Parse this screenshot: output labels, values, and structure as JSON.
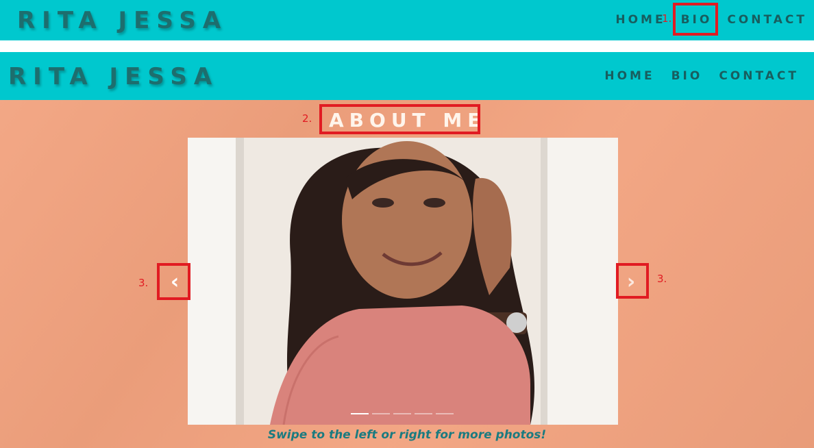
{
  "top_nav": {
    "brand": "RITA JESSA",
    "links": [
      "HOME",
      "BIO",
      "CONTACT"
    ]
  },
  "main_nav": {
    "brand": "RITA JESSA",
    "links": [
      "HOME",
      "BIO",
      "CONTACT"
    ]
  },
  "about": {
    "title": "ABOUT ME",
    "carousel": {
      "prev_icon": "chevron-left-icon",
      "next_icon": "chevron-right-icon",
      "slide_count": 5,
      "active_slide": 1
    },
    "caption": "Swipe to the left or right for more photos!"
  },
  "annotations": {
    "bio_marker": "1.",
    "title_marker": "2.",
    "prev_marker": "3.",
    "next_marker": "3."
  },
  "colors": {
    "header_bg": "#00c8ce",
    "brand_text": "#1d6e6e",
    "content_bg": "#f2a27e",
    "annotation_red": "#e11b22",
    "caption_text": "#1b7b80"
  }
}
